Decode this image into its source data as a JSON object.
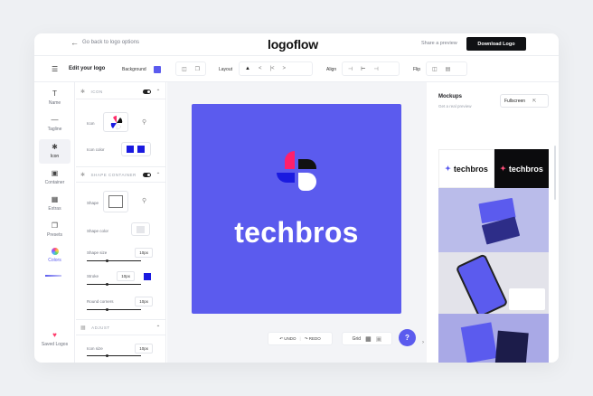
{
  "topbar": {
    "back_label": "Go back to logo options",
    "logo": "logoflow",
    "share_label": "Share a preview",
    "download_label": "Download Logo"
  },
  "toolbar": {
    "edit_label": "Edit your logo",
    "background_label": "Background",
    "background_color": "#5b5bee",
    "layout_label": "Layout",
    "align_label": "Align",
    "flip_label": "Flip"
  },
  "rail": {
    "items": [
      {
        "label": "Name",
        "icon": "text-icon"
      },
      {
        "label": "Tagline",
        "icon": "tagline-icon"
      },
      {
        "label": "Icon",
        "icon": "icon-icon"
      },
      {
        "label": "Container",
        "icon": "container-icon"
      },
      {
        "label": "Extras",
        "icon": "extras-icon"
      },
      {
        "label": "Presets",
        "icon": "presets-icon"
      },
      {
        "label": "Colors",
        "icon": "palette-icon"
      }
    ],
    "saved_label": "Saved Logos"
  },
  "panel": {
    "icon_section": "ICON",
    "icon_label": "Icon",
    "icon_color_label": "Icon color",
    "icon_colors": [
      "#1a1ae0",
      "#1a1ae0"
    ],
    "shape_section": "SHAPE CONTAINER",
    "shape_label": "Shape",
    "shape_color_label": "Shape color",
    "shape_size_label": "Shape size",
    "shape_size_value": "10px",
    "stroke_label": "Stroke",
    "stroke_value": "10px",
    "stroke_color": "#1a1ae0",
    "round_label": "Round corners",
    "round_value": "10px",
    "adjust_section": "ADJUST",
    "icon_size_label": "Icon size",
    "icon_size_value": "10px"
  },
  "canvas": {
    "artboard_color": "#5b5bee",
    "brand_name": "techbros",
    "undo_label": "UNDO",
    "redo_label": "REDO",
    "grid_label": "Grid",
    "help_label": "?"
  },
  "mockups": {
    "title": "Mockups",
    "subtitle": "Get a real preview",
    "fullscreen_label": "Fullscreen",
    "brand_name": "techbros"
  }
}
